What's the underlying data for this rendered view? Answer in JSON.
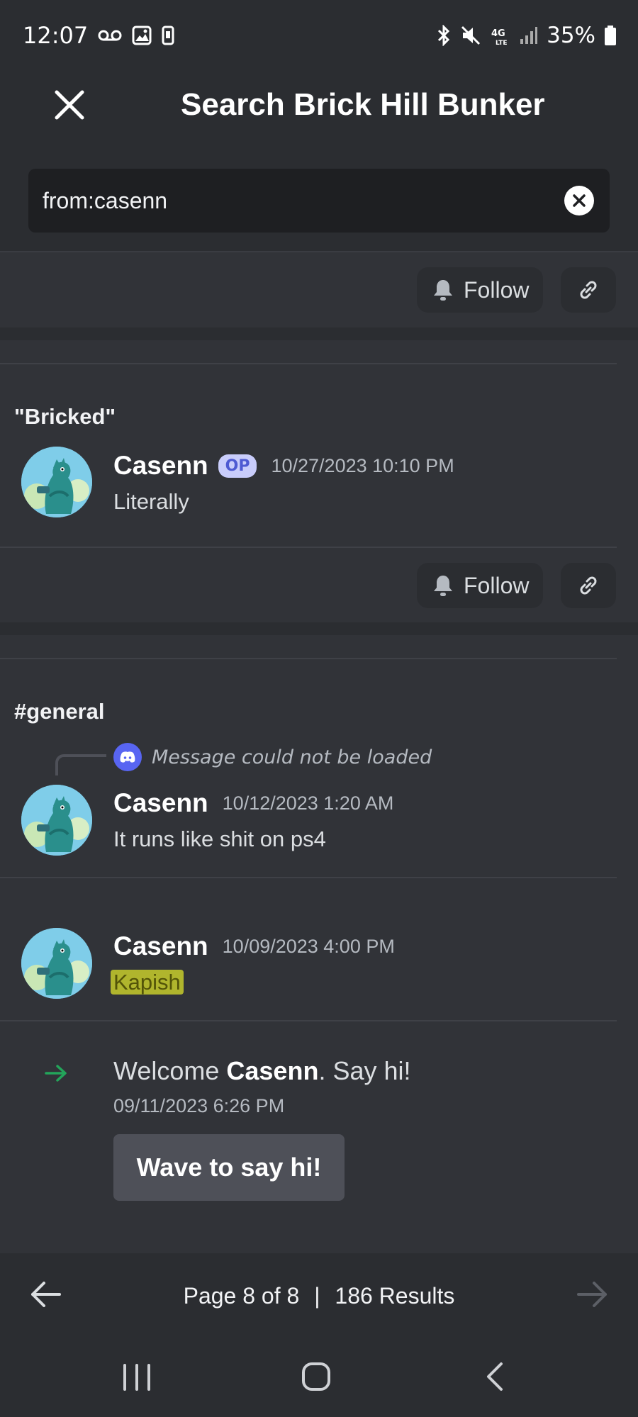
{
  "status_bar": {
    "time": "12:07",
    "battery": "35%",
    "icons": [
      "voicemail-icon",
      "image-icon",
      "phone-icon",
      "bluetooth-icon",
      "mute-icon",
      "4g-lte-icon",
      "signal-icon",
      "battery-icon"
    ]
  },
  "header": {
    "title": "Search Brick Hill Bunker"
  },
  "search": {
    "query": "from:casenn"
  },
  "actions": {
    "follow_label": "Follow"
  },
  "results": [
    {
      "channel": "\"Bricked\"",
      "author": "Casenn",
      "badge": "OP",
      "timestamp": "10/27/2023 10:10 PM",
      "text": "Literally"
    },
    {
      "channel": "#general",
      "reply_ref": "Message could not be loaded",
      "author": "Casenn",
      "timestamp": "10/12/2023 1:20 AM",
      "text": "It runs like shit on ps4"
    },
    {
      "author": "Casenn",
      "timestamp": "10/09/2023 4:00 PM",
      "text": "Kapish"
    }
  ],
  "welcome": {
    "prefix": "Welcome ",
    "name": "Casenn",
    "suffix": ". Say hi!",
    "timestamp": "09/11/2023 6:26 PM",
    "button": "Wave to say hi!"
  },
  "pagination": {
    "page_text": "Page 8 of 8",
    "separator": "|",
    "results_text": "186 Results"
  },
  "colors": {
    "background": "#313338",
    "surface": "#2b2d31",
    "highlight": "#c7cc2c",
    "op_badge": "#c9cdfb",
    "join_arrow": "#23a55a",
    "blurple": "#5865f2"
  }
}
